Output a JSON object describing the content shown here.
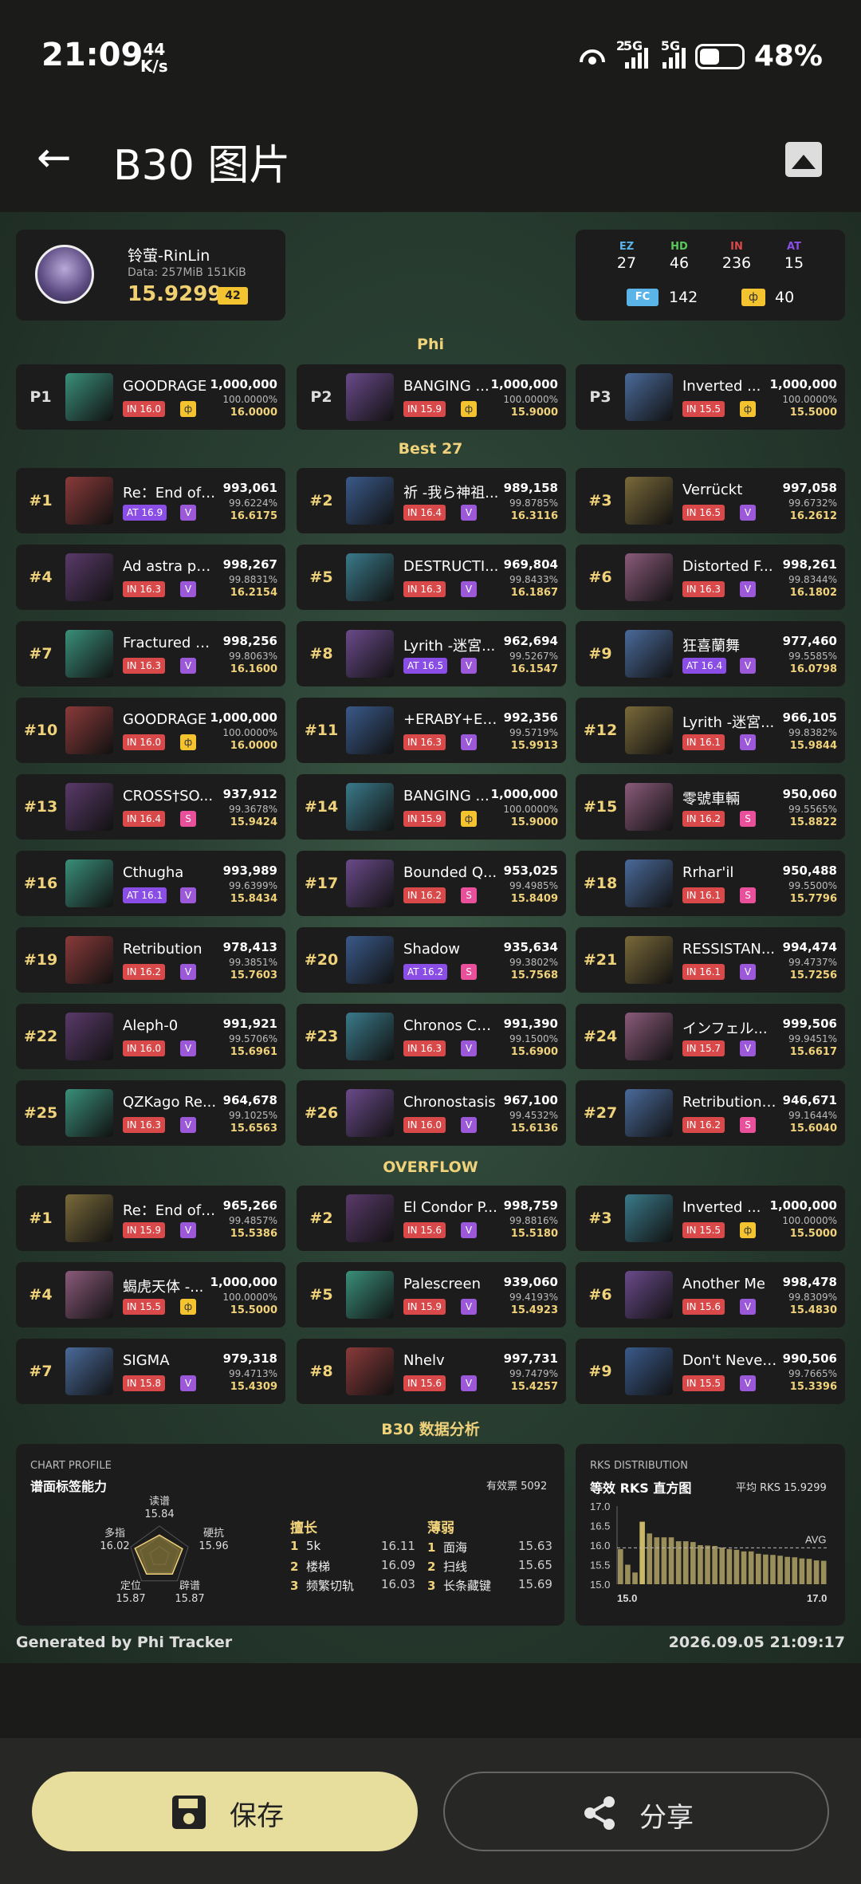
{
  "status": {
    "time": "21:09",
    "speed_top": "44",
    "speed_unit": "K/s",
    "sig1_label": "2",
    "sig2_label": "5G",
    "sig3_label": "5G",
    "battery": "48%"
  },
  "appbar": {
    "title": "B30 图片",
    "back_icon": "back-arrow-icon",
    "image_icon": "image-icon"
  },
  "profile": {
    "name": "铃萤-RinLin",
    "data": "Data: 257MiB 151KiB",
    "rks": "15.9299",
    "badge": "42"
  },
  "stats": {
    "ez_l": "EZ",
    "ez": "27",
    "hd_l": "HD",
    "hd": "46",
    "in_l": "IN",
    "in": "236",
    "at_l": "AT",
    "at": "15",
    "fc_l": "FC",
    "fc": "142",
    "phi_l": "ф",
    "phi": "40"
  },
  "sections": {
    "phi": "Phi",
    "best": "Best 27",
    "overflow": "OVERFLOW",
    "analysis": "B30 数据分析"
  },
  "phi": [
    {
      "rank": "P1",
      "name": "GOODRAGE",
      "diff": "IN 16.0",
      "grade": "ф",
      "score": "1,000,000",
      "acc": "100.0000%",
      "rks": "16.0000"
    },
    {
      "rank": "P2",
      "name": "BANGING ...",
      "diff": "IN 15.9",
      "grade": "ф",
      "score": "1,000,000",
      "acc": "100.0000%",
      "rks": "15.9000"
    },
    {
      "rank": "P3",
      "name": "Inverted ...",
      "diff": "IN 15.5",
      "grade": "ф",
      "score": "1,000,000",
      "acc": "100.0000%",
      "rks": "15.5000"
    }
  ],
  "best": [
    {
      "rank": "#1",
      "name": "Re：End of ...",
      "diff": "AT 16.9",
      "grade": "V",
      "score": "993,061",
      "acc": "99.6224%",
      "rks": "16.6175"
    },
    {
      "rank": "#2",
      "name": "祈 -我ら神祖...",
      "diff": "IN 16.4",
      "grade": "V",
      "score": "989,158",
      "acc": "99.8785%",
      "rks": "16.3116"
    },
    {
      "rank": "#3",
      "name": "Verrückt",
      "diff": "IN 16.5",
      "grade": "V",
      "score": "997,058",
      "acc": "99.6732%",
      "rks": "16.2612"
    },
    {
      "rank": "#4",
      "name": "Ad astra pe...",
      "diff": "IN 16.3",
      "grade": "V",
      "score": "998,267",
      "acc": "99.8831%",
      "rks": "16.2154"
    },
    {
      "rank": "#5",
      "name": "DESTRUCTI...",
      "diff": "IN 16.3",
      "grade": "V",
      "score": "969,804",
      "acc": "99.8433%",
      "rks": "16.1867"
    },
    {
      "rank": "#6",
      "name": "Distorted F...",
      "diff": "IN 16.3",
      "grade": "V",
      "score": "998,261",
      "acc": "99.8344%",
      "rks": "16.1802"
    },
    {
      "rank": "#7",
      "name": "Fractured A...",
      "diff": "IN 16.3",
      "grade": "V",
      "score": "998,256",
      "acc": "99.8063%",
      "rks": "16.1600"
    },
    {
      "rank": "#8",
      "name": "Lyrith -迷宮...",
      "diff": "AT 16.5",
      "grade": "V",
      "score": "962,694",
      "acc": "99.5267%",
      "rks": "16.1547"
    },
    {
      "rank": "#9",
      "name": "狂喜蘭舞",
      "diff": "AT 16.4",
      "grade": "V",
      "score": "977,460",
      "acc": "99.5585%",
      "rks": "16.0798"
    },
    {
      "rank": "#10",
      "name": "GOODRAGE",
      "diff": "IN 16.0",
      "grade": "ф",
      "score": "1,000,000",
      "acc": "100.0000%",
      "rks": "16.0000"
    },
    {
      "rank": "#11",
      "name": "+ERABY+E ...",
      "diff": "IN 16.3",
      "grade": "V",
      "score": "992,356",
      "acc": "99.5719%",
      "rks": "15.9913"
    },
    {
      "rank": "#12",
      "name": "Lyrith -迷宮...",
      "diff": "IN 16.1",
      "grade": "V",
      "score": "966,105",
      "acc": "99.8382%",
      "rks": "15.9844"
    },
    {
      "rank": "#13",
      "name": "CROSS†SO...",
      "diff": "IN 16.4",
      "grade": "S",
      "score": "937,912",
      "acc": "99.3678%",
      "rks": "15.9424"
    },
    {
      "rank": "#14",
      "name": "BANGING ...",
      "diff": "IN 15.9",
      "grade": "ф",
      "score": "1,000,000",
      "acc": "100.0000%",
      "rks": "15.9000"
    },
    {
      "rank": "#15",
      "name": "零號車輛",
      "diff": "IN 16.2",
      "grade": "S",
      "score": "950,060",
      "acc": "99.5565%",
      "rks": "15.8822"
    },
    {
      "rank": "#16",
      "name": "Cthugha",
      "diff": "AT 16.1",
      "grade": "V",
      "score": "993,989",
      "acc": "99.6399%",
      "rks": "15.8434"
    },
    {
      "rank": "#17",
      "name": "Bounded Q...",
      "diff": "IN 16.2",
      "grade": "S",
      "score": "953,025",
      "acc": "99.4985%",
      "rks": "15.8409"
    },
    {
      "rank": "#18",
      "name": "Rrhar'il",
      "diff": "IN 16.1",
      "grade": "S",
      "score": "950,488",
      "acc": "99.5500%",
      "rks": "15.7796"
    },
    {
      "rank": "#19",
      "name": "Retribution",
      "diff": "IN 16.2",
      "grade": "V",
      "score": "978,413",
      "acc": "99.3851%",
      "rks": "15.7603"
    },
    {
      "rank": "#20",
      "name": "Shadow",
      "diff": "AT 16.2",
      "grade": "S",
      "score": "935,634",
      "acc": "99.3802%",
      "rks": "15.7568"
    },
    {
      "rank": "#21",
      "name": "RESSISTAN...",
      "diff": "IN 16.1",
      "grade": "V",
      "score": "994,474",
      "acc": "99.4737%",
      "rks": "15.7256"
    },
    {
      "rank": "#22",
      "name": "Aleph-0",
      "diff": "IN 16.0",
      "grade": "V",
      "score": "991,921",
      "acc": "99.5706%",
      "rks": "15.6961"
    },
    {
      "rank": "#23",
      "name": "Chronos Col...",
      "diff": "IN 16.3",
      "grade": "V",
      "score": "991,390",
      "acc": "99.1500%",
      "rks": "15.6900"
    },
    {
      "rank": "#24",
      "name": "インフェル...",
      "diff": "IN 15.7",
      "grade": "V",
      "score": "999,506",
      "acc": "99.9451%",
      "rks": "15.6617"
    },
    {
      "rank": "#25",
      "name": "QZKago Re...",
      "diff": "IN 16.3",
      "grade": "V",
      "score": "964,678",
      "acc": "99.1025%",
      "rks": "15.6563"
    },
    {
      "rank": "#26",
      "name": "Chronostasis",
      "diff": "IN 16.0",
      "grade": "V",
      "score": "967,100",
      "acc": "99.4532%",
      "rks": "15.6136"
    },
    {
      "rank": "#27",
      "name": "Retribution ...",
      "diff": "IN 16.2",
      "grade": "S",
      "score": "946,671",
      "acc": "99.1644%",
      "rks": "15.6040"
    }
  ],
  "overflow": [
    {
      "rank": "#1",
      "name": "Re：End of ...",
      "diff": "IN 15.9",
      "grade": "V",
      "score": "965,266",
      "acc": "99.4857%",
      "rks": "15.5386"
    },
    {
      "rank": "#2",
      "name": "El Condor P...",
      "diff": "IN 15.6",
      "grade": "V",
      "score": "998,759",
      "acc": "99.8816%",
      "rks": "15.5180"
    },
    {
      "rank": "#3",
      "name": "Inverted ...",
      "diff": "IN 15.5",
      "grade": "ф",
      "score": "1,000,000",
      "acc": "100.0000%",
      "rks": "15.5000"
    },
    {
      "rank": "#4",
      "name": "蝎虎天体 -...",
      "diff": "IN 15.5",
      "grade": "ф",
      "score": "1,000,000",
      "acc": "100.0000%",
      "rks": "15.5000"
    },
    {
      "rank": "#5",
      "name": "Palescreen",
      "diff": "IN 15.9",
      "grade": "V",
      "score": "939,060",
      "acc": "99.4193%",
      "rks": "15.4923"
    },
    {
      "rank": "#6",
      "name": "Another Me",
      "diff": "IN 15.6",
      "grade": "V",
      "score": "998,478",
      "acc": "99.8309%",
      "rks": "15.4830"
    },
    {
      "rank": "#7",
      "name": "SIGMA",
      "diff": "IN 15.8",
      "grade": "V",
      "score": "979,318",
      "acc": "99.4713%",
      "rks": "15.4309"
    },
    {
      "rank": "#8",
      "name": "Nhelv",
      "diff": "IN 15.6",
      "grade": "V",
      "score": "997,731",
      "acc": "99.7479%",
      "rks": "15.4257"
    },
    {
      "rank": "#9",
      "name": "Don't Never...",
      "diff": "IN 15.5",
      "grade": "V",
      "score": "990,506",
      "acc": "99.7665%",
      "rks": "15.3396"
    }
  ],
  "chart_profile": {
    "small": "CHART PROFILE",
    "title": "谱面标签能力",
    "votes": "有效票 5092",
    "radar": [
      {
        "label": "读谱",
        "value": 15.84
      },
      {
        "label": "硬抗",
        "value": 15.96
      },
      {
        "label": "辟谱",
        "value": 15.87
      },
      {
        "label": "定位",
        "value": 15.87
      },
      {
        "label": "多指",
        "value": 16.02
      }
    ],
    "strong_title": "擅长",
    "strong": [
      {
        "n": "1",
        "label": "5k",
        "v": "16.11"
      },
      {
        "n": "2",
        "label": "楼梯",
        "v": "16.09"
      },
      {
        "n": "3",
        "label": "频繁切轨",
        "v": "16.03"
      }
    ],
    "weak_title": "薄弱",
    "weak": [
      {
        "n": "1",
        "label": "面海",
        "v": "15.63"
      },
      {
        "n": "2",
        "label": "扫线",
        "v": "15.65"
      },
      {
        "n": "3",
        "label": "长条藏键",
        "v": "15.69"
      }
    ]
  },
  "chart_data": {
    "type": "bar",
    "small": "RKS DISTRIBUTION",
    "title": "等效 RKS 直方图",
    "avg_text": "平均 RKS 15.9299",
    "avg_label": "AVG",
    "avg": 15.9299,
    "ylim": [
      15.0,
      17.0
    ],
    "yticks": [
      "17.0",
      "16.5",
      "16.0",
      "15.5",
      "15.0"
    ],
    "xticks": [
      "15.0",
      "17.0"
    ],
    "values": [
      15.9,
      15.5,
      15.3,
      16.6,
      16.3,
      16.2,
      16.2,
      16.2,
      16.1,
      16.1,
      16.08,
      16.0,
      15.99,
      15.98,
      15.94,
      15.9,
      15.88,
      15.84,
      15.84,
      15.78,
      15.76,
      15.75,
      15.73,
      15.7,
      15.69,
      15.66,
      15.65,
      15.61,
      15.6
    ]
  },
  "footer": {
    "left": "Generated by Phi Tracker",
    "right": "2026.09.05 21:09:17"
  },
  "buttons": {
    "save": "保存",
    "share": "分享",
    "save_icon": "save-icon",
    "share_icon": "share-icon"
  },
  "colors": {
    "IN": "#d9494a",
    "AT": "#8a4ee6",
    "HD": "#5ac85a",
    "EZ": "#5ab4e8",
    "V": "#9b59d9",
    "S": "#e8509c",
    "phi": "#f4c430"
  }
}
